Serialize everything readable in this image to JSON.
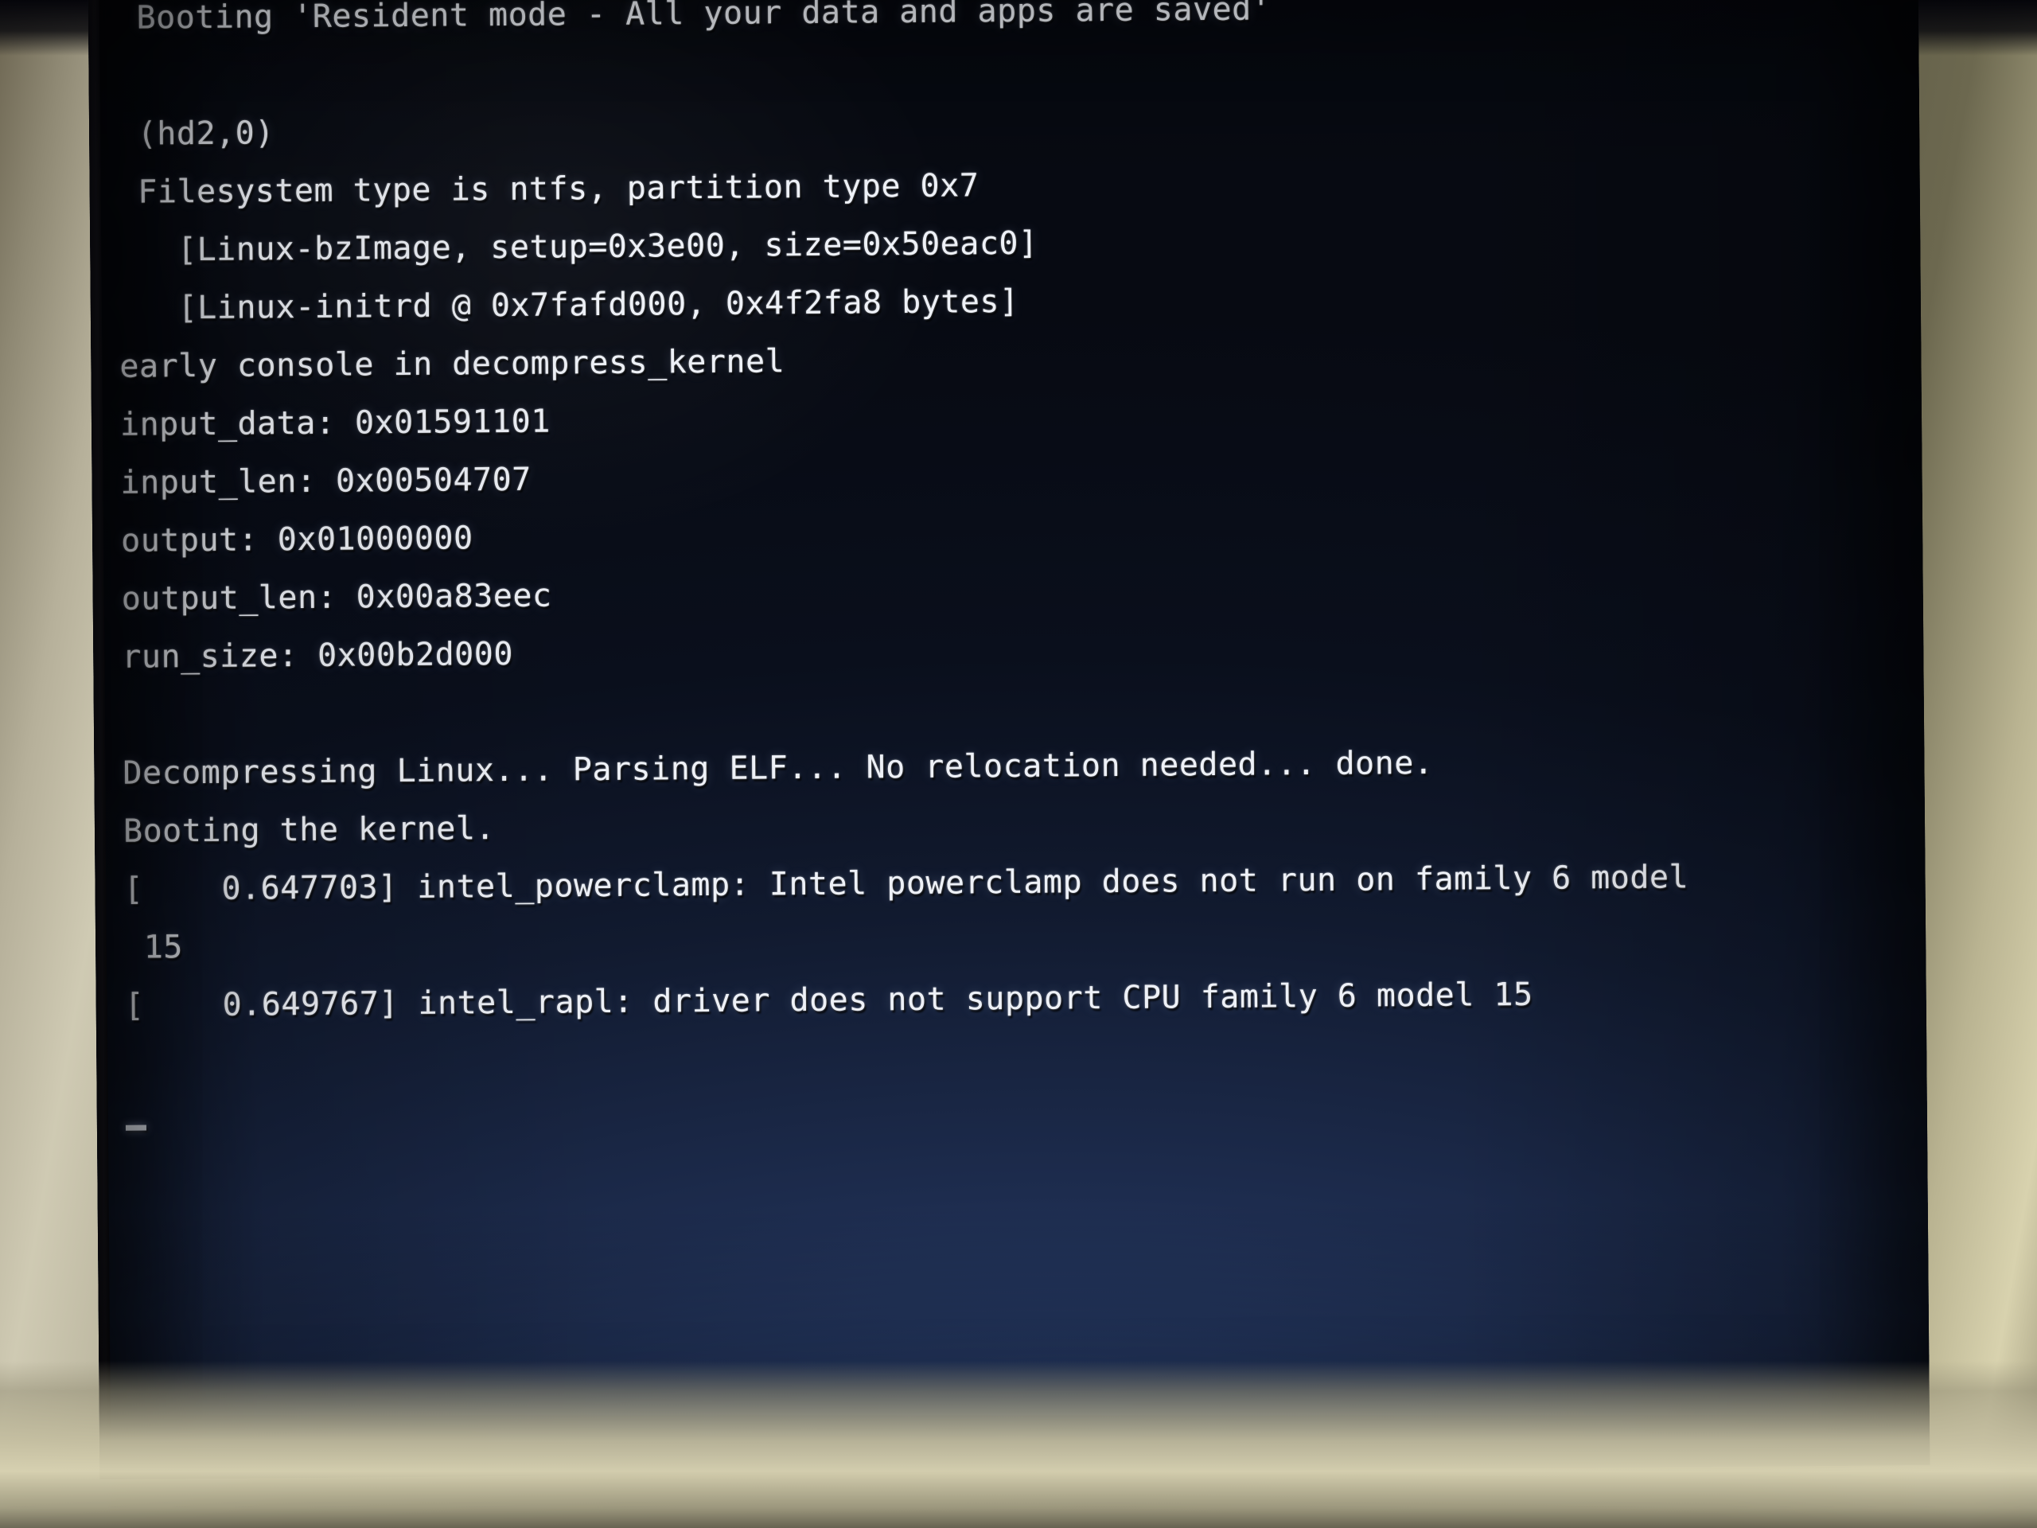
{
  "device": {
    "kind": "crt-monitor-photograph",
    "bezel_color": "#cfcab3",
    "screen_bg_color": "#0d1220",
    "text_color": "#eef1f7",
    "backlight_glow_color": "#37568f"
  },
  "console": {
    "title_line": "Booting 'Resident mode - All your data and apps are saved'",
    "cursor_glyph": "_",
    "lines": [
      {
        "id": "boot-entry",
        "text": "Booting 'Resident mode - All your data and apps are saved'",
        "indent": 1
      },
      {
        "id": "blank-1",
        "text": "",
        "indent": 0
      },
      {
        "id": "grub-device",
        "text": "(hd2,0)",
        "indent": 1
      },
      {
        "id": "grub-filesystem",
        "text": "Filesystem type is ntfs, partition type 0x7",
        "indent": 1
      },
      {
        "id": "grub-bzimage",
        "text": "[Linux-bzImage, setup=0x3e00, size=0x50eac0]",
        "indent": 3
      },
      {
        "id": "grub-initrd",
        "text": "[Linux-initrd @ 0x7fafd000, 0x4f2fa8 bytes]",
        "indent": 3
      },
      {
        "id": "early-console",
        "text": "early console in decompress_kernel",
        "indent": 0
      },
      {
        "id": "input-data",
        "text": "input_data: 0x01591101",
        "indent": 0
      },
      {
        "id": "input-len",
        "text": "input_len: 0x00504707",
        "indent": 0
      },
      {
        "id": "output",
        "text": "output: 0x01000000",
        "indent": 0
      },
      {
        "id": "output-len",
        "text": "output_len: 0x00a83eec",
        "indent": 0
      },
      {
        "id": "run-size",
        "text": "run_size: 0x00b2d000",
        "indent": 0
      },
      {
        "id": "blank-2",
        "text": "",
        "indent": 0
      },
      {
        "id": "decompressing",
        "text": "Decompressing Linux... Parsing ELF... No relocation needed... done.",
        "indent": 0
      },
      {
        "id": "booting-kernel",
        "text": "Booting the kernel.",
        "indent": 0
      },
      {
        "id": "msg-powerclamp",
        "text": "[    0.647703] intel_powerclamp: Intel powerclamp does not run on family 6 model",
        "indent": 0
      },
      {
        "id": "msg-powerclamp-wrap",
        "text": " 15",
        "indent": 0
      },
      {
        "id": "msg-rapl",
        "text": "[    0.649767] intel_rapl: driver does not support CPU family 6 model 15",
        "indent": 0
      }
    ],
    "kernel_messages": [
      {
        "timestamp": "0.647703",
        "subsystem": "intel_powerclamp",
        "message": "Intel powerclamp does not run on family 6 model 15"
      },
      {
        "timestamp": "0.649767",
        "subsystem": "intel_rapl",
        "message": "driver does not support CPU family 6 model 15"
      }
    ],
    "bootloader": {
      "device": "(hd2,0)",
      "filesystem_type": "ntfs",
      "partition_type": "0x7",
      "bzimage_setup": "0x3e00",
      "bzimage_size": "0x50eac0",
      "initrd_address": "0x7fafd000",
      "initrd_bytes": "0x4f2fa8"
    },
    "decompressor": {
      "input_data": "0x01591101",
      "input_len": "0x00504707",
      "output": "0x01000000",
      "output_len": "0x00a83eec",
      "run_size": "0x00b2d000",
      "status": "Decompressing Linux... Parsing ELF... No relocation needed... done."
    }
  }
}
